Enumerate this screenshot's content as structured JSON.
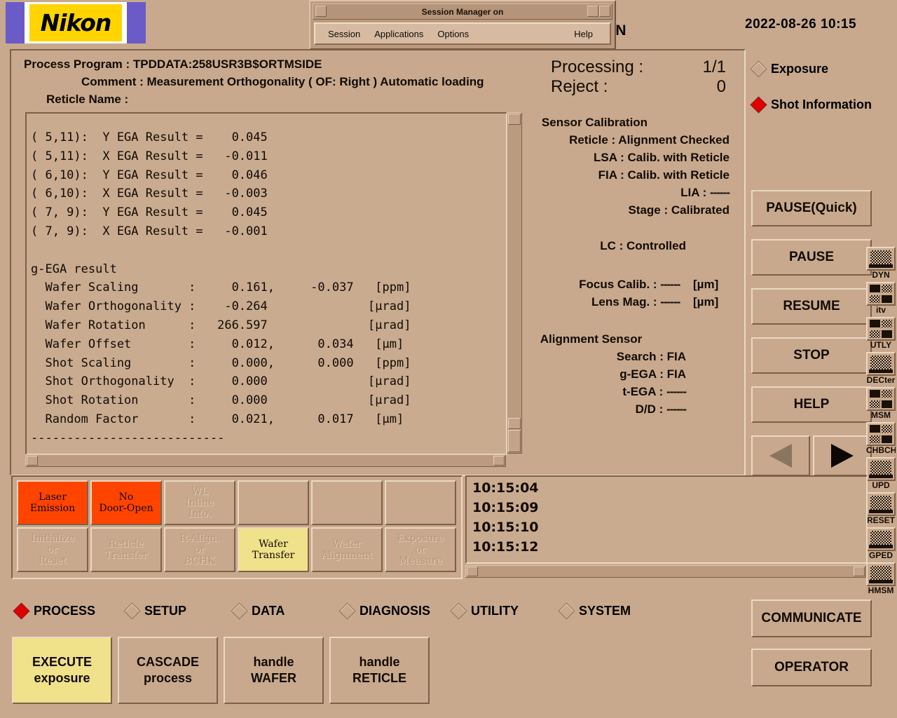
{
  "brand": {
    "name": "Nikon"
  },
  "header": {
    "status_on": "ON",
    "datetime": "2022-08-26 10:15"
  },
  "session_manager": {
    "title": "Session Manager on",
    "menus": [
      "Session",
      "Applications",
      "Options"
    ],
    "help": "Help"
  },
  "process": {
    "program_label": "Process Program :",
    "program_value": "TPDDATA:258USR3B$ORTMSIDE",
    "comment_label": "Comment :",
    "comment_value": "Measurement Orthogonality ( OF: Right ) Automatic loading",
    "reticle_label": "Reticle Name :",
    "reticle_value": "",
    "processing_label": "Processing :",
    "processing_value": "1/1",
    "reject_label": "Reject :",
    "reject_value": "0"
  },
  "log": {
    "text": "( 5,11):  Y EGA Result =    0.045\n( 5,11):  X EGA Result =   -0.011\n( 6,10):  Y EGA Result =    0.046\n( 6,10):  X EGA Result =   -0.003\n( 7, 9):  Y EGA Result =    0.045\n( 7, 9):  X EGA Result =   -0.001\n\ng-EGA result\n  Wafer Scaling       :     0.161,     -0.037   [ppm]\n  Wafer Orthogonality :    -0.264              [µrad]\n  Wafer Rotation      :   266.597              [µrad]\n  Wafer Offset        :     0.012,      0.034   [µm]\n  Shot Scaling        :     0.000,      0.000   [ppm]\n  Shot Orthogonality  :     0.000              [µrad]\n  Shot Rotation       :     0.000              [µrad]\n  Random Factor       :     0.021,      0.017   [µm]\n---------------------------"
  },
  "sensor": {
    "title": "Sensor Calibration",
    "rows": [
      {
        "label": "Reticle :",
        "value": "Alignment Checked",
        "unit": ""
      },
      {
        "label": "LSA :",
        "value": "Calib. with Reticle",
        "unit": ""
      },
      {
        "label": "FIA :",
        "value": "Calib. with Reticle",
        "unit": ""
      },
      {
        "label": "LIA :",
        "value": "------",
        "unit": ""
      },
      {
        "label": "Stage :",
        "value": "Calibrated",
        "unit": ""
      }
    ],
    "lc_label": "LC :",
    "lc_value": "Controlled",
    "focus_label": "Focus Calib. :",
    "focus_value": "------",
    "focus_unit": "[µm]",
    "lensmag_label": "Lens Mag. :",
    "lensmag_value": "------",
    "lensmag_unit": "[µm]"
  },
  "alignment_sensor": {
    "title": "Alignment Sensor",
    "rows": [
      {
        "label": "Search :",
        "value": "FIA"
      },
      {
        "label": "g-EGA :",
        "value": "FIA"
      },
      {
        "label": "t-EGA :",
        "value": "------"
      },
      {
        "label": "D/D :",
        "value": "------"
      }
    ]
  },
  "view_radios": [
    {
      "label": "Exposure",
      "selected": false
    },
    {
      "label": "Shot Information",
      "selected": true
    }
  ],
  "control_buttons": [
    {
      "label": "PAUSE(Quick)"
    },
    {
      "label": "PAUSE"
    },
    {
      "label": "RESUME"
    },
    {
      "label": "STOP"
    },
    {
      "label": "HELP"
    }
  ],
  "nav_arrows": {
    "prev": "prev-arrow",
    "next": "next-arrow"
  },
  "side_buttons": [
    {
      "label": "COMMUNICATE"
    },
    {
      "label": "OPERATOR"
    }
  ],
  "icon_strip": [
    {
      "label": "DYN",
      "glyph": "screen"
    },
    {
      "label": "itv",
      "glyph": "quad"
    },
    {
      "label": "UTLY",
      "glyph": "quad"
    },
    {
      "label": "DECter",
      "glyph": "screen"
    },
    {
      "label": "MSM",
      "glyph": "quad"
    },
    {
      "label": "CHBCH",
      "glyph": "quad"
    },
    {
      "label": "UPD",
      "glyph": "screen"
    },
    {
      "label": "RESET",
      "glyph": "screen"
    },
    {
      "label": "GPED",
      "glyph": "screen"
    },
    {
      "label": "HMSM",
      "glyph": "screen"
    }
  ],
  "status_grid": {
    "row1": [
      {
        "label": "Laser\nEmission",
        "state": "alarm"
      },
      {
        "label": "No\nDoor-Open",
        "state": "alarm"
      },
      {
        "label": "WL\nInline\nInfo.",
        "state": "idle"
      },
      {
        "label": "",
        "state": "blank"
      },
      {
        "label": "",
        "state": "blank"
      },
      {
        "label": "",
        "state": "blank"
      }
    ],
    "row2": [
      {
        "label": "Initialize\nor\nReset",
        "state": "idle"
      },
      {
        "label": "Reticle\nTransfer",
        "state": "idle"
      },
      {
        "label": "R-Align.\nor\nBCHK",
        "state": "idle"
      },
      {
        "label": "Wafer\nTransfer",
        "state": "active"
      },
      {
        "label": "Wafer\nAlignment",
        "state": "idle"
      },
      {
        "label": "Exposure\nor\nMeasure",
        "state": "idle"
      }
    ]
  },
  "timestamps": [
    "10:15:04",
    "10:15:09",
    "10:15:10",
    "10:15:12"
  ],
  "mode_radios": [
    {
      "label": "PROCESS",
      "selected": true
    },
    {
      "label": "SETUP",
      "selected": false
    },
    {
      "label": "DATA",
      "selected": false
    },
    {
      "label": "DIAGNOSIS",
      "selected": false
    },
    {
      "label": "UTILITY",
      "selected": false
    },
    {
      "label": "SYSTEM",
      "selected": false
    }
  ],
  "action_buttons": [
    {
      "line1": "EXECUTE",
      "line2": "exposure",
      "highlight": true
    },
    {
      "line1": "CASCADE",
      "line2": "process",
      "highlight": false
    },
    {
      "line1": "handle",
      "line2": "WAFER",
      "highlight": false
    },
    {
      "line1": "handle",
      "line2": "RETICLE",
      "highlight": false
    }
  ],
  "colors": {
    "background": "#c8a98d",
    "alarm": "#ff4400",
    "active": "#f0e18b",
    "accent_red": "#e00000",
    "logo_purple": "#6a5bc8",
    "logo_yellow": "#ffd400"
  }
}
